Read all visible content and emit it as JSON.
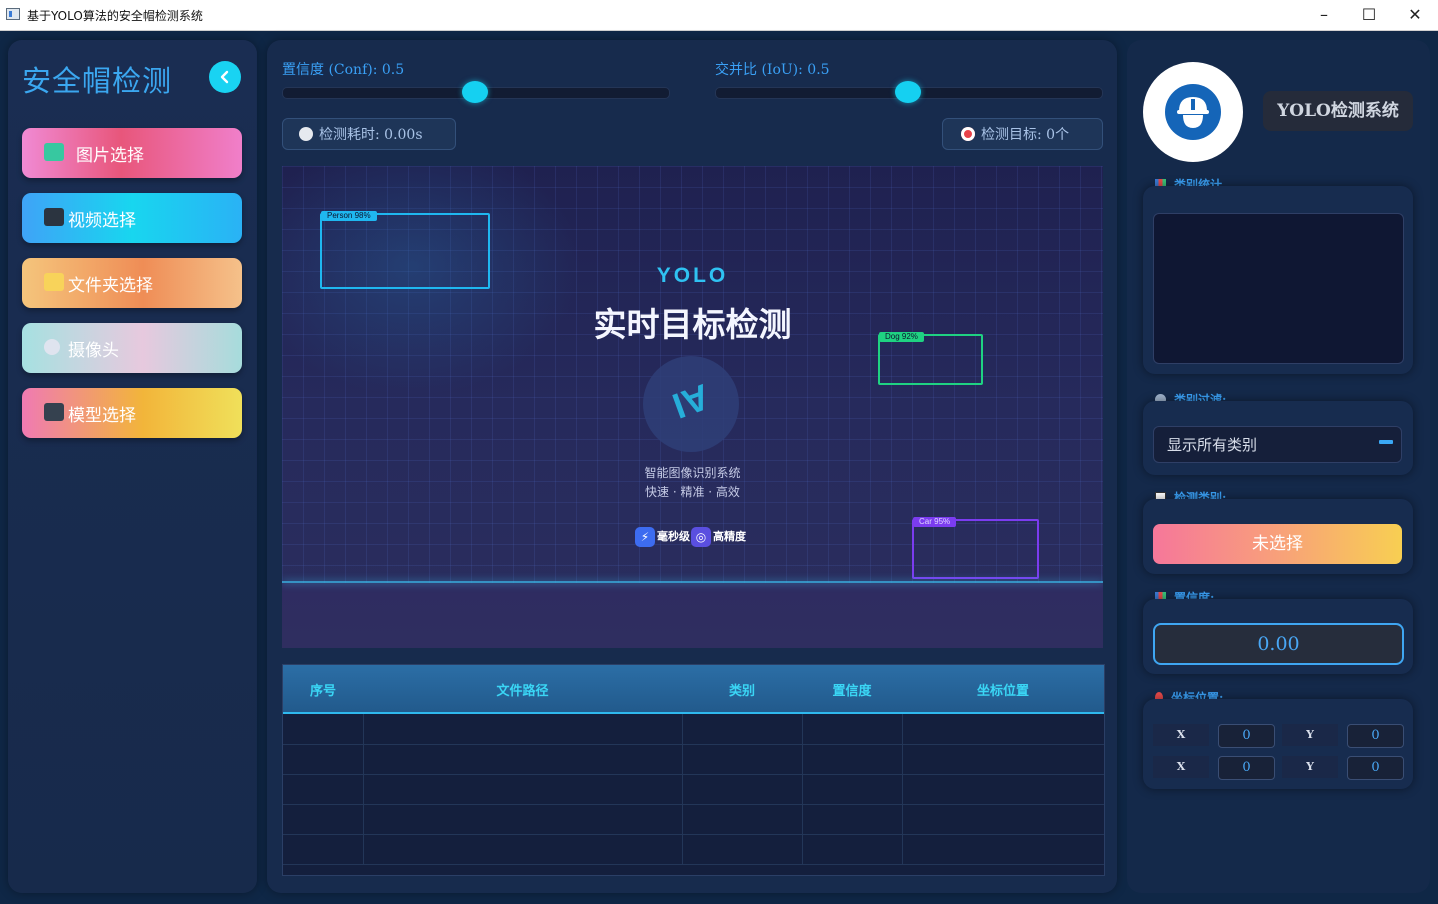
{
  "window": {
    "title": "基于YOLO算法的安全帽检测系统",
    "minimize": "–",
    "maximize": "☐",
    "close": "✕"
  },
  "sidebar": {
    "title": "安全帽检测",
    "items": [
      {
        "label": "图片选择",
        "icon": "image-icon"
      },
      {
        "label": "视频选择",
        "icon": "clapperboard-icon"
      },
      {
        "label": "文件夹选择",
        "icon": "folder-icon"
      },
      {
        "label": "摄像头",
        "icon": "webcam-icon"
      },
      {
        "label": "模型选择",
        "icon": "robot-icon"
      }
    ]
  },
  "controls": {
    "conf_label": "置信度 (Conf): 0.5",
    "conf_value": 0.5,
    "iou_label": "交并比 (IoU): 0.5",
    "iou_value": 0.5,
    "time_label": "检测耗时: 0.00s",
    "target_label": "检测目标: 0个"
  },
  "preview": {
    "yolo": "YOLO",
    "headline": "实时目标检测",
    "ai_text": "AI",
    "sub1": "智能图像识别系统",
    "sub2": "快速 · 精准 · 高效",
    "badge1": "毫秒级",
    "badge2": "高精度",
    "boxes": [
      {
        "label": "Person 98%",
        "color": "#1fb7f0"
      },
      {
        "label": "Dog 92%",
        "color": "#1fd282"
      },
      {
        "label": "Car 95%",
        "color": "#7b3cf0"
      }
    ]
  },
  "table": {
    "headers": [
      "序号",
      "文件路径",
      "类别",
      "置信度",
      "坐标位置"
    ],
    "rows": [
      [
        "",
        "",
        "",
        "",
        ""
      ],
      [
        "",
        "",
        "",
        "",
        ""
      ],
      [
        "",
        "",
        "",
        "",
        ""
      ],
      [
        "",
        "",
        "",
        "",
        ""
      ],
      [
        "",
        "",
        "",
        "",
        ""
      ]
    ]
  },
  "right": {
    "system_tag": "YOLO检测系统",
    "stats_label": "类别统计",
    "filter_label": "类别过滤:",
    "filter_value": "显示所有类别",
    "det_label": "检测类别:",
    "det_value": "未选择",
    "conf_label": "置信度:",
    "conf_value": "0.00",
    "coord_label": "坐标位置:",
    "coords": [
      {
        "key": "X",
        "value": "0"
      },
      {
        "key": "Y",
        "value": "0"
      },
      {
        "key": "X",
        "value": "0"
      },
      {
        "key": "Y",
        "value": "0"
      }
    ]
  },
  "colors": {
    "accent": "#3aa0f5",
    "cyan": "#15d0f1",
    "panel": "#172b4d"
  }
}
